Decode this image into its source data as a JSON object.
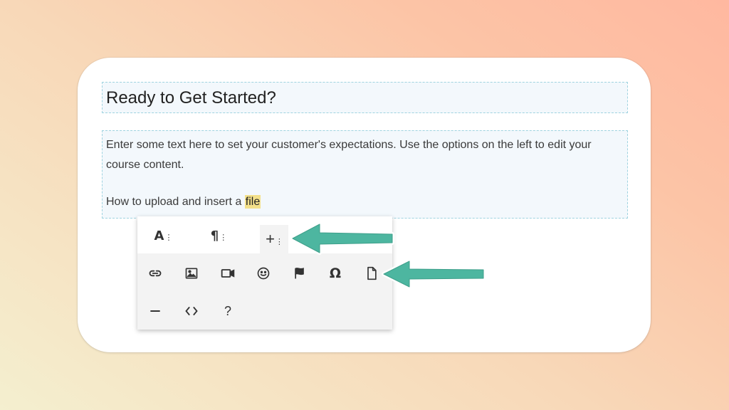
{
  "editor": {
    "title": "Ready to Get Started?",
    "body": "Enter some text here to set your customer's expectations. Use the options on the left to edit your course content.",
    "line_prefix": "How to upload and insert a ",
    "highlighted_word": "file"
  },
  "toolbar": {
    "tabs": [
      {
        "name": "text-format",
        "glyph": "A",
        "icon": "text-format-icon"
      },
      {
        "name": "paragraph-format",
        "glyph": "¶",
        "icon": "paragraph-icon"
      },
      {
        "name": "insert",
        "glyph": "+",
        "icon": "plus-icon",
        "active": true
      }
    ],
    "row1": [
      {
        "name": "insert-link",
        "icon": "link-icon"
      },
      {
        "name": "insert-image",
        "icon": "image-icon"
      },
      {
        "name": "insert-video",
        "icon": "video-icon"
      },
      {
        "name": "insert-emoticon",
        "icon": "smiley-icon"
      },
      {
        "name": "insert-flag",
        "icon": "flag-icon"
      },
      {
        "name": "special-characters",
        "glyph": "Ω",
        "icon": "omega-icon"
      },
      {
        "name": "insert-file",
        "icon": "file-icon"
      }
    ],
    "row2": [
      {
        "name": "horizontal-line",
        "icon": "horizontal-line-icon"
      },
      {
        "name": "code-view",
        "icon": "code-icon"
      },
      {
        "name": "help",
        "glyph": "?",
        "icon": "help-icon"
      }
    ]
  },
  "colors": {
    "arrow": "#4db6a0",
    "highlight": "#f3e08a",
    "block_border": "#9fd3e0"
  }
}
